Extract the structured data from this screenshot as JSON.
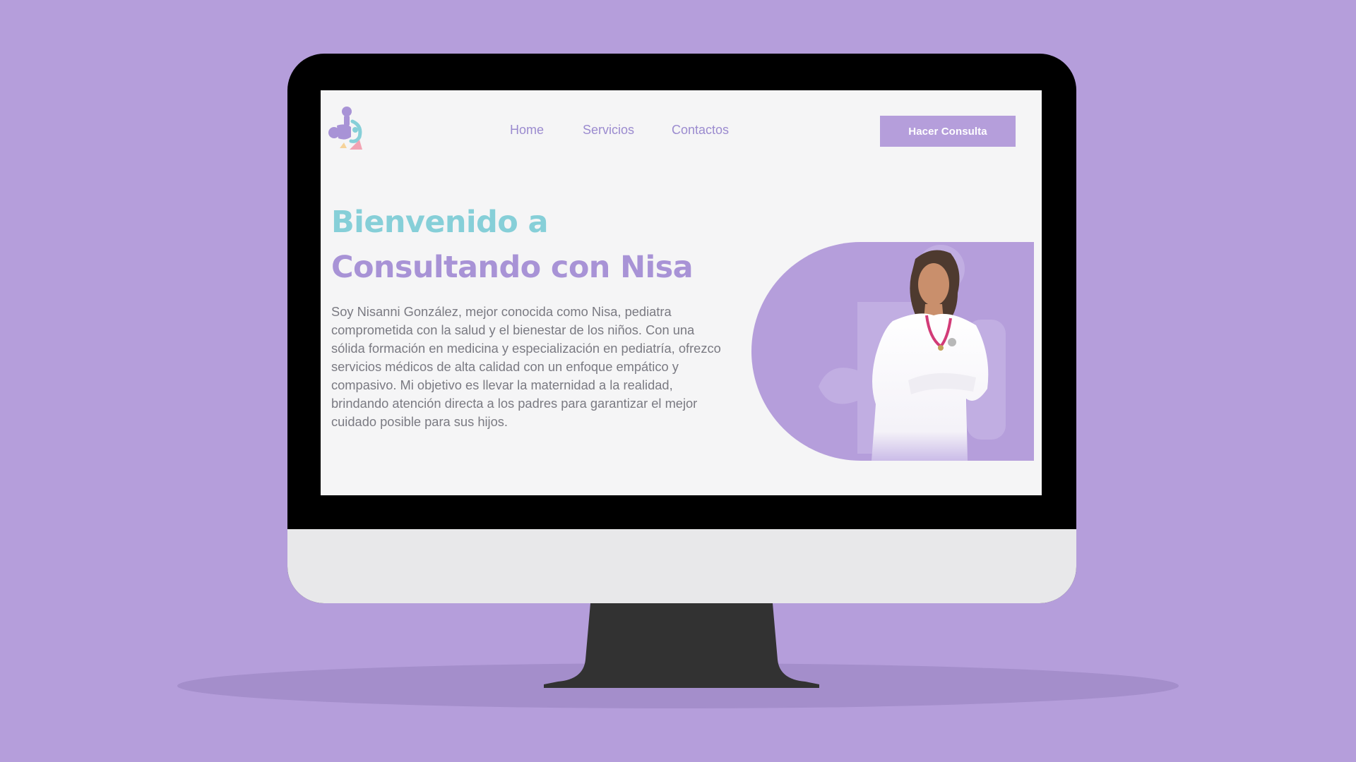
{
  "brand": {
    "logo_icon": "puzzle-family-logo-icon"
  },
  "nav": {
    "items": [
      {
        "label": "Home"
      },
      {
        "label": "Servicios"
      },
      {
        "label": "Contactos"
      }
    ],
    "cta_label": "Hacer Consulta"
  },
  "hero": {
    "title_line1": "Bienvenido a",
    "title_line2": "Consultando con Nisa",
    "description": "Soy Nisanni González, mejor conocida como Nisa, pediatra comprometida con la salud y el bienestar de los niños. Con una sólida formación en medicina y especialización en pediatría, ofrezco servicios médicos de alta calidad con un enfoque empático y compasivo. Mi objetivo es llevar la maternidad a la realidad, brindando atención directa a los padres para garantizar el mejor cuidado posible para sus hijos.",
    "image_icon": "doctor-portrait-icon"
  },
  "colors": {
    "background": "#b59edb",
    "accent_purple": "#a893d6",
    "accent_teal": "#86cfd8",
    "nav_text": "#9b8bcf",
    "body_text": "#7a7a82",
    "screen_bg": "#f5f5f6"
  }
}
